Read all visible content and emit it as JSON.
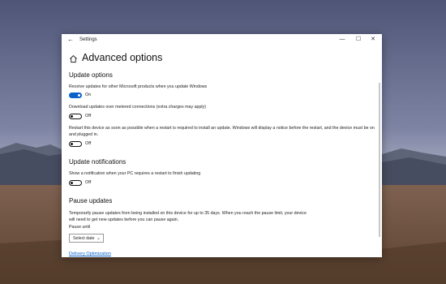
{
  "window": {
    "title": "Settings",
    "back_icon": "back-arrow-icon",
    "controls": [
      "minimize-icon",
      "maximize-icon",
      "close-icon"
    ]
  },
  "page": {
    "title": "Advanced options",
    "home_icon": "home-icon"
  },
  "update_options": {
    "heading": "Update options",
    "items": [
      {
        "label": "Receive updates for other Microsoft products when you update Windows",
        "state": "On"
      },
      {
        "label": "Download updates over metered connections (extra charges may apply)",
        "state": "Off"
      },
      {
        "label": "Restart this device as soon as possible when a restart is required to install an update. Windows will display a notice before the restart, and the device must be on and plugged in.",
        "state": "Off"
      }
    ]
  },
  "update_notifications": {
    "heading": "Update notifications",
    "items": [
      {
        "label": "Show a notification when your PC requires a restart to finish updating",
        "state": "Off"
      }
    ]
  },
  "pause_updates": {
    "heading": "Pause updates",
    "description": "Temporarily pause updates from being installed on this device for up to 35 days. When you reach the pause limit, your device will need to get new updates before you can pause again.",
    "pause_until_label": "Pause until",
    "select_value": "Select date"
  },
  "links": {
    "delivery_optimization": "Delivery Optimization"
  },
  "colors": {
    "accent": "#0a62c9"
  }
}
